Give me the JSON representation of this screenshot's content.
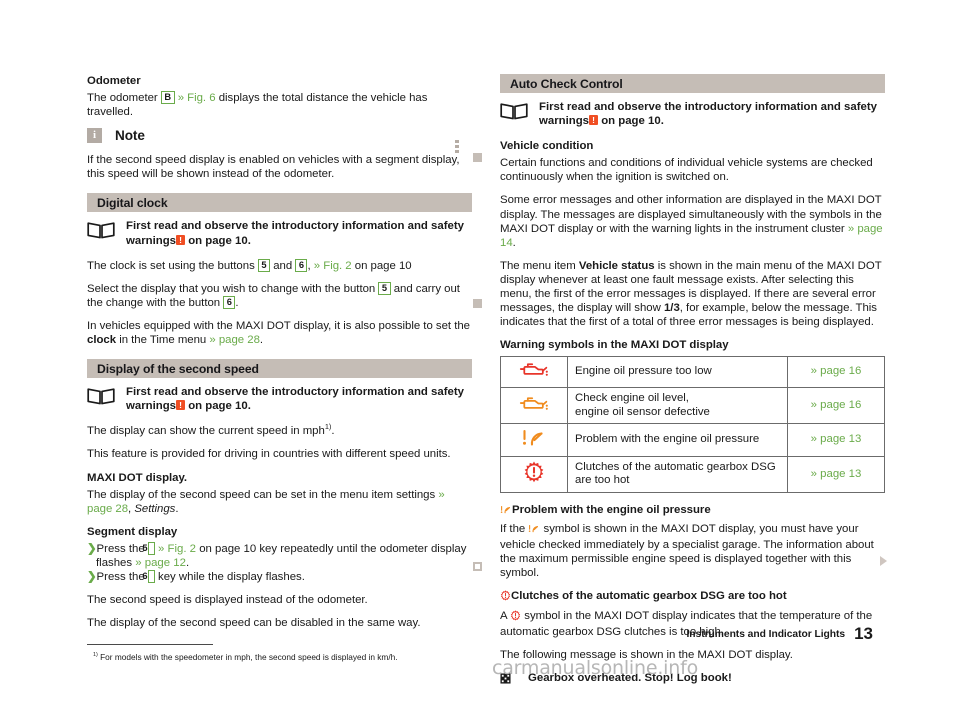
{
  "document": {
    "footer_chapter": "Instruments and Indicator Lights",
    "page_number": "13",
    "watermark": "carmanualsonline.info"
  },
  "colors": {
    "section_bar": "#c5bdb6",
    "xref_green": "#6aab4a",
    "warn_red": "#e8352a",
    "warn_orange": "#f08c1e",
    "chip_orange": "#f04e23",
    "table_border": "#6b6b6b"
  },
  "left_column": {
    "odometer": {
      "heading": "Odometer",
      "line_pre": "The odometer",
      "key": "B",
      "xref": "» Fig. 6",
      "line_post": "displays the total distance the vehicle has travelled."
    },
    "note": {
      "icon_letter": "i",
      "label": "Note",
      "body": "If the second speed display is enabled on vehicles with a segment display, this speed will be shown instead of the odometer."
    },
    "digital_clock": {
      "section_title": "Digital clock",
      "intro_pre": "First read and observe the introductory information and safety warnings",
      "intro_chip": "!",
      "intro_post": "on page 10.",
      "p1_pre": "The clock is set using the buttons",
      "p1_key1": "5",
      "p1_and": "and",
      "p1_key2": "6",
      "p1_xref": "» Fig. 2",
      "p1_post": "on page 10",
      "p2_pre": "Select the display that you wish to change with the button",
      "p2_key1": "5",
      "p2_mid": "and carry out the change with the button",
      "p2_key2": "6",
      "p2_post": ".",
      "p3_pre": "In vehicles equipped with the MAXI DOT display, it is also possible to set the",
      "p3_bold": "clock",
      "p3_mid": "in the Time menu",
      "p3_xref": "» page 28",
      "p3_post": "."
    },
    "second_speed": {
      "section_title": "Display of the second speed",
      "intro_pre": "First read and observe the introductory information and safety warnings",
      "intro_chip": "!",
      "intro_post": "on page 10.",
      "p1_pre": "The display can show the current speed in mph",
      "p1_footnote_marker": "1)",
      "p1_post": ".",
      "p2": "This feature is provided for driving in countries with different speed units.",
      "maxi_heading": "MAXI DOT display.",
      "maxi_body_pre": "The display of the second speed can be set in the menu item settings",
      "maxi_xref": "» page 28",
      "maxi_body_mid": ",",
      "maxi_italic": "Settings",
      "maxi_body_post": ".",
      "segment_heading": "Segment display",
      "bullets": [
        {
          "pre": "Press the",
          "key": "5",
          "xref": "» Fig. 2",
          "mid": "on page 10 key repeatedly until the odometer display flashes",
          "xref2": "» page 12",
          "post": "."
        },
        {
          "pre": "Press the",
          "key": "6",
          "mid": "key while the display flashes.",
          "xref2": "",
          "post": ""
        }
      ],
      "p3": "The second speed is displayed instead of the odometer.",
      "p4": "The display of the second speed can be disabled in the same way."
    },
    "footnote": {
      "marker": "1)",
      "text": "For models with the speedometer in mph, the second speed is displayed in km/h."
    }
  },
  "right_column": {
    "auto_check_control": {
      "section_title": "Auto Check Control",
      "intro_pre": "First read and observe the introductory information and safety warnings",
      "intro_chip": "!",
      "intro_post": "on page 10.",
      "vehicle_condition_heading": "Vehicle condition",
      "vehicle_condition_body": "Certain functions and conditions of individual vehicle systems are checked continuously when the ignition is switched on.",
      "p2_pre": "Some error messages and other information are displayed in the MAXI DOT display. The messages are displayed simultaneously with the symbols in the MAXI DOT display or with the warning lights in the instrument cluster",
      "p2_xref": "» page 14",
      "p2_post": ".",
      "p3_pre": "The menu item",
      "p3_bold1": "Vehicle status",
      "p3_mid1": "is shown in the main menu of the MAXI DOT display whenever at least one fault message exists. After selecting this menu, the first of the error messages is displayed. If there are several error messages, the display will show",
      "p3_bold2": "1/3",
      "p3_post": ", for example, below the message. This indicates that the first of a total of three error messages is being displayed.",
      "table_heading": "Warning symbols in the MAXI DOT display",
      "table": {
        "rows": [
          {
            "icon": "oil-can-red-icon",
            "icon_color": "#e8352a",
            "description": "Engine oil pressure too low",
            "reference": "» page 16"
          },
          {
            "icon": "oil-can-orange-icon",
            "icon_color": "#f08c1e",
            "description": "Check engine oil level,\nengine oil sensor defective",
            "reference": "» page 16"
          },
          {
            "icon": "oil-pressure-gauge-orange-icon",
            "icon_color": "#f08c1e",
            "description": "Problem with the engine oil pressure",
            "reference": "» page 13"
          },
          {
            "icon": "gear-exclamation-red-icon",
            "icon_color": "#e8352a",
            "description": "Clutches of the automatic gearbox DSG are too hot",
            "reference": "» page 13"
          }
        ]
      },
      "oil_pressure": {
        "heading": "Problem with the engine oil pressure",
        "body_pre": "If the",
        "body_post": "symbol is shown in the MAXI DOT display, you must have your vehicle checked immediately by a specialist garage. The information about the maximum permissible engine speed is displayed together with this symbol."
      },
      "dsg_clutches": {
        "heading": "Clutches of the automatic gearbox DSG are too hot",
        "body_pre": "A",
        "body_post": "symbol in the MAXI DOT display indicates that the temperature of the automatic gearbox DSG clutches is too high."
      },
      "following_message": "The following message is shown in the MAXI DOT display.",
      "display_message": "Gearbox overheated. Stop! Log book!"
    }
  }
}
